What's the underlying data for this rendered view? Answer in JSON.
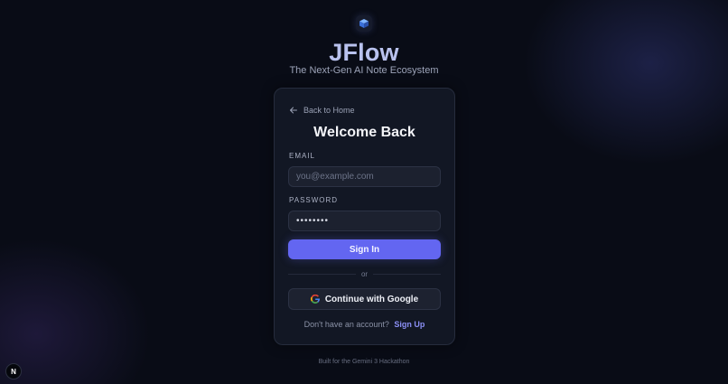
{
  "brand": {
    "title": "JFlow",
    "subtitle": "The Next-Gen AI Note Ecosystem",
    "logo_icon": "cube-icon"
  },
  "card": {
    "back_link": "Back to Home",
    "heading": "Welcome Back",
    "email": {
      "label": "EMAIL",
      "placeholder": "you@example.com",
      "value": ""
    },
    "password": {
      "label": "PASSWORD",
      "value": "••••••••"
    },
    "signin_label": "Sign In",
    "divider_text": "or",
    "google_label": "Continue with Google",
    "signup_prompt": "Don't have an account?",
    "signup_link": "Sign Up"
  },
  "footer": {
    "text": "Built for the Gemini 3 Hackathon"
  },
  "dev_badge": {
    "letter": "N",
    "icon": "nextjs-icon"
  },
  "colors": {
    "background": "#090c16",
    "card": "#121724",
    "accent": "#6366f1",
    "title": "#b9c2ee",
    "link": "#8b8ff5"
  }
}
